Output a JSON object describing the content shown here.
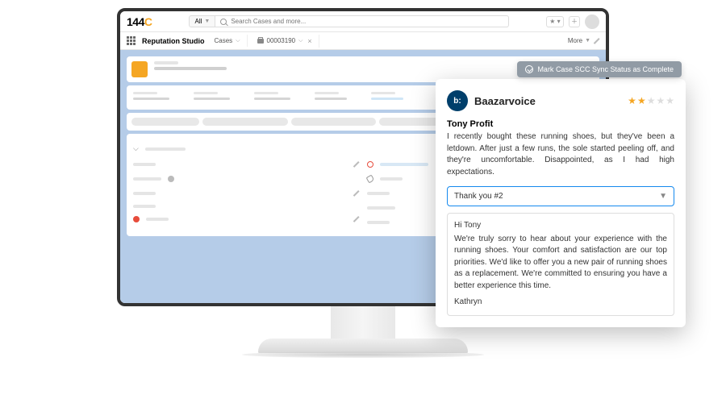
{
  "topbar": {
    "logo_text": "144",
    "logo_accent": "C",
    "search_scope": "All",
    "search_placeholder": "Search Cases and more..."
  },
  "navbar": {
    "app_name": "Reputation Studio",
    "tab_cases": "Cases",
    "tab_case_number": "00003190",
    "more_label": "More"
  },
  "sync_button": "Mark Case SCC Sync Status as Complete",
  "review": {
    "source_logo_text": "b:",
    "source_name": "Baazarvoice",
    "rating": 2,
    "reviewer": "Tony Profit",
    "text": "I recently bought these running shoes, but they've been a letdown. After just a few runs, the sole started peeling off, and they're uncomfortable. Disappointed, as I had high expectations.",
    "template_selected": "Thank you #2",
    "response_greeting": "Hi Tony",
    "response_body": "We're truly sorry to hear about your experience with the running shoes. Your comfort and satisfaction are our top priorities. We'd like to offer you a new pair of running shoes as a replacement. We're committed to ensuring you have a better experience this time.",
    "response_signoff": "Kathryn"
  }
}
